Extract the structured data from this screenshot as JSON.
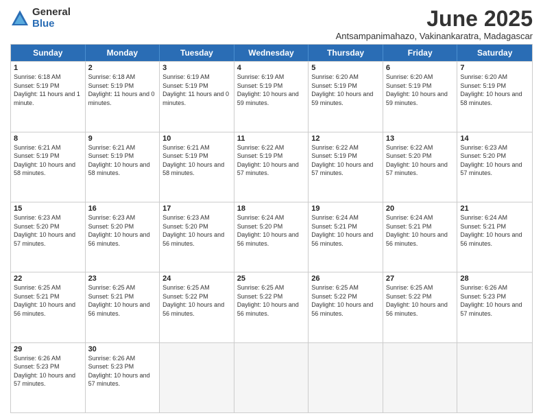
{
  "logo": {
    "general": "General",
    "blue": "Blue"
  },
  "title": "June 2025",
  "subtitle": "Antsampanimahazo, Vakinankaratra, Madagascar",
  "header_days": [
    "Sunday",
    "Monday",
    "Tuesday",
    "Wednesday",
    "Thursday",
    "Friday",
    "Saturday"
  ],
  "rows": [
    [
      {
        "day": "1",
        "sunrise": "6:18 AM",
        "sunset": "5:19 PM",
        "daylight": "11 hours and 1 minute."
      },
      {
        "day": "2",
        "sunrise": "6:18 AM",
        "sunset": "5:19 PM",
        "daylight": "11 hours and 0 minutes."
      },
      {
        "day": "3",
        "sunrise": "6:19 AM",
        "sunset": "5:19 PM",
        "daylight": "11 hours and 0 minutes."
      },
      {
        "day": "4",
        "sunrise": "6:19 AM",
        "sunset": "5:19 PM",
        "daylight": "10 hours and 59 minutes."
      },
      {
        "day": "5",
        "sunrise": "6:20 AM",
        "sunset": "5:19 PM",
        "daylight": "10 hours and 59 minutes."
      },
      {
        "day": "6",
        "sunrise": "6:20 AM",
        "sunset": "5:19 PM",
        "daylight": "10 hours and 59 minutes."
      },
      {
        "day": "7",
        "sunrise": "6:20 AM",
        "sunset": "5:19 PM",
        "daylight": "10 hours and 58 minutes."
      }
    ],
    [
      {
        "day": "8",
        "sunrise": "6:21 AM",
        "sunset": "5:19 PM",
        "daylight": "10 hours and 58 minutes."
      },
      {
        "day": "9",
        "sunrise": "6:21 AM",
        "sunset": "5:19 PM",
        "daylight": "10 hours and 58 minutes."
      },
      {
        "day": "10",
        "sunrise": "6:21 AM",
        "sunset": "5:19 PM",
        "daylight": "10 hours and 58 minutes."
      },
      {
        "day": "11",
        "sunrise": "6:22 AM",
        "sunset": "5:19 PM",
        "daylight": "10 hours and 57 minutes."
      },
      {
        "day": "12",
        "sunrise": "6:22 AM",
        "sunset": "5:19 PM",
        "daylight": "10 hours and 57 minutes."
      },
      {
        "day": "13",
        "sunrise": "6:22 AM",
        "sunset": "5:20 PM",
        "daylight": "10 hours and 57 minutes."
      },
      {
        "day": "14",
        "sunrise": "6:23 AM",
        "sunset": "5:20 PM",
        "daylight": "10 hours and 57 minutes."
      }
    ],
    [
      {
        "day": "15",
        "sunrise": "6:23 AM",
        "sunset": "5:20 PM",
        "daylight": "10 hours and 57 minutes."
      },
      {
        "day": "16",
        "sunrise": "6:23 AM",
        "sunset": "5:20 PM",
        "daylight": "10 hours and 56 minutes."
      },
      {
        "day": "17",
        "sunrise": "6:23 AM",
        "sunset": "5:20 PM",
        "daylight": "10 hours and 56 minutes."
      },
      {
        "day": "18",
        "sunrise": "6:24 AM",
        "sunset": "5:20 PM",
        "daylight": "10 hours and 56 minutes."
      },
      {
        "day": "19",
        "sunrise": "6:24 AM",
        "sunset": "5:21 PM",
        "daylight": "10 hours and 56 minutes."
      },
      {
        "day": "20",
        "sunrise": "6:24 AM",
        "sunset": "5:21 PM",
        "daylight": "10 hours and 56 minutes."
      },
      {
        "day": "21",
        "sunrise": "6:24 AM",
        "sunset": "5:21 PM",
        "daylight": "10 hours and 56 minutes."
      }
    ],
    [
      {
        "day": "22",
        "sunrise": "6:25 AM",
        "sunset": "5:21 PM",
        "daylight": "10 hours and 56 minutes."
      },
      {
        "day": "23",
        "sunrise": "6:25 AM",
        "sunset": "5:21 PM",
        "daylight": "10 hours and 56 minutes."
      },
      {
        "day": "24",
        "sunrise": "6:25 AM",
        "sunset": "5:22 PM",
        "daylight": "10 hours and 56 minutes."
      },
      {
        "day": "25",
        "sunrise": "6:25 AM",
        "sunset": "5:22 PM",
        "daylight": "10 hours and 56 minutes."
      },
      {
        "day": "26",
        "sunrise": "6:25 AM",
        "sunset": "5:22 PM",
        "daylight": "10 hours and 56 minutes."
      },
      {
        "day": "27",
        "sunrise": "6:25 AM",
        "sunset": "5:22 PM",
        "daylight": "10 hours and 56 minutes."
      },
      {
        "day": "28",
        "sunrise": "6:26 AM",
        "sunset": "5:23 PM",
        "daylight": "10 hours and 57 minutes."
      }
    ],
    [
      {
        "day": "29",
        "sunrise": "6:26 AM",
        "sunset": "5:23 PM",
        "daylight": "10 hours and 57 minutes."
      },
      {
        "day": "30",
        "sunrise": "6:26 AM",
        "sunset": "5:23 PM",
        "daylight": "10 hours and 57 minutes."
      },
      null,
      null,
      null,
      null,
      null
    ]
  ]
}
